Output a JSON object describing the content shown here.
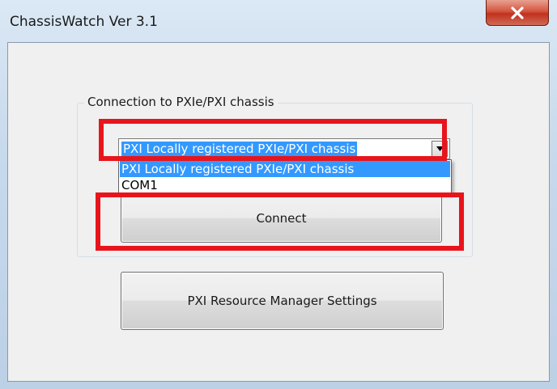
{
  "window": {
    "title": "ChassisWatch Ver 3.1"
  },
  "titlebar": {
    "close_icon": "close-x-icon",
    "close_color": "#c9412c"
  },
  "group": {
    "legend": "Connection to PXIe/PXI chassis"
  },
  "combo": {
    "selected_value": "PXI Locally registered PXIe/PXI chassis",
    "arrow_icon": "chevron-down-icon",
    "dropdown_open": true,
    "options": [
      "PXI Locally registered PXIe/PXI chassis",
      "COM1"
    ],
    "highlighted_option_index": 0
  },
  "buttons": {
    "connect_label": "Connect",
    "resource_manager_label": "PXI Resource Manager Settings"
  },
  "annotations": {
    "highlight_color": "#e8141b",
    "highlight_targets": [
      "connection-combo",
      "connect-button"
    ]
  }
}
